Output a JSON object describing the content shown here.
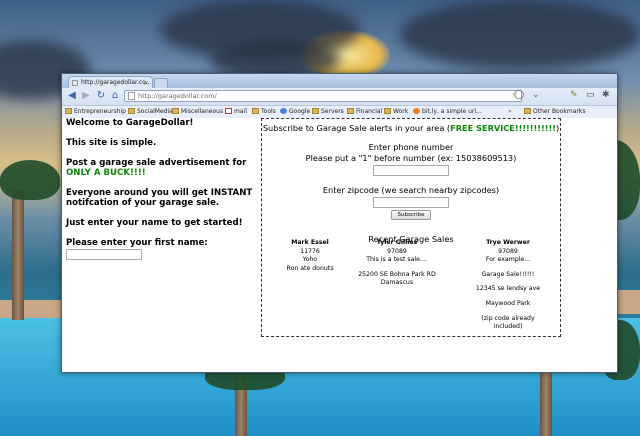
{
  "browser": {
    "tab_title": "http://garagedollar.co...",
    "url": "http://garagedollar.com/",
    "bookmarks": [
      "Entrepreneurship",
      "SocialMedia",
      "Miscellaneous",
      "mail",
      "Tools",
      "Google",
      "Servers",
      "Financial",
      "Work",
      "bit.ly, a simple url..."
    ],
    "other_bookmarks": "Other Bookmarks"
  },
  "left": {
    "welcome": "Welcome to GarageDollar!",
    "simple": "This site is simple.",
    "post_text": "Post a garage sale advertisement for",
    "price": "ONLY A BUCK!!!!",
    "everyone": "Everyone around you will get INSTANT notifcation of your garage sale.",
    "enter_name": "Just enter your name to get started!",
    "first_name_label": "Please enter your first name:",
    "first_name_value": ""
  },
  "subscribe": {
    "title_prefix": "Subscribe to Garage Sale alerts in your area (",
    "free": "FREE SERVICE!!!!!!!!!!!",
    "title_suffix": ")",
    "phone_label": "Enter phone number",
    "phone_hint": "Please put a \"1\" before number (ex: 15038609513)",
    "phone_value": "",
    "zip_label": "Enter zipcode (we search nearby zipcodes)",
    "zip_value": "",
    "button": "Subscribe"
  },
  "recent": {
    "title": "Recent Garage Sales",
    "sales": [
      {
        "name": "Mark Essel",
        "zip": "11776",
        "lines": [
          "Yoho",
          "Ron ate donuts"
        ]
      },
      {
        "name": "Tyler Gillies",
        "zip": "97089",
        "lines": [
          "This is a test sale....",
          "",
          "25200 SE Bohna Park RD",
          "Damascus"
        ]
      },
      {
        "name": "Trye Werwer",
        "zip": "97089",
        "lines": [
          "For example...",
          "",
          "Garage Sale!!!!!!",
          "",
          "12345 se lendsy ave",
          "",
          "Maywood Park",
          "",
          "(zip code already",
          "included)"
        ]
      }
    ]
  },
  "colors": {
    "green": "#0a8a0a",
    "toolbar": "#d5e1f1"
  }
}
